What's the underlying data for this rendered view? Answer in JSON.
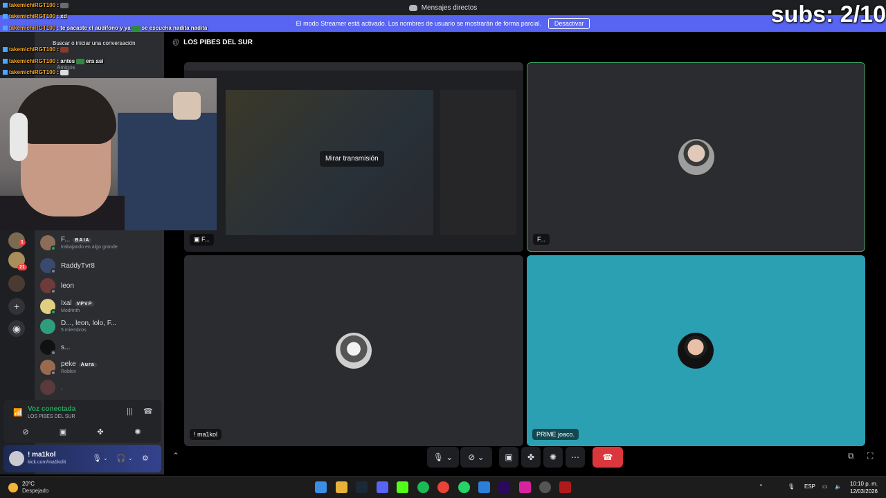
{
  "titlebar": {
    "title": "Mensajes directos"
  },
  "banner": {
    "text": "El modo Streamer está activado. Los nombres de usuario se mostrarán de forma parcial.",
    "button": "Desactivar"
  },
  "overlay": {
    "subs": "subs: 2/10"
  },
  "chat": {
    "messages": [
      {
        "user": "takemichiRGT100",
        "text": ":"
      },
      {
        "user": "takemichiRGT100",
        "text": ": xd"
      },
      {
        "user": "takemichiRGT100",
        "text": ": te sacaste el audifono y ya"
      },
      {
        "user": "",
        "text": "se escucha nadita nadita"
      },
      {
        "user": "takemichiRGT100",
        "text": ":"
      },
      {
        "user": "takemichiRGT100",
        "text": ": antes"
      },
      {
        "user": "",
        "text": "era asi"
      },
      {
        "user": "takemichiRGT100",
        "text": ":"
      }
    ]
  },
  "sidebar": {
    "search_placeholder": "Buscar o iniciar una conversación",
    "friends": "Amigos",
    "badges": {
      "b1": "1",
      "b2": "21"
    },
    "items": [
      {
        "name": "F...",
        "tag": "BAIA",
        "sub": "trabajando en algo grande"
      },
      {
        "name": "RaddyTvr8",
        "sub": ""
      },
      {
        "name": "leon",
        "sub": ""
      },
      {
        "name": "Ixal",
        "tag": "VPVP",
        "sub": "Modrinth"
      },
      {
        "name": "D..., leon, lolo, F...",
        "sub": "5 miembros"
      },
      {
        "name": "s...",
        "sub": ""
      },
      {
        "name": "peke",
        "tag": "Aura",
        "sub": "Roblox"
      },
      {
        "name": ".",
        "sub": ""
      }
    ]
  },
  "voice": {
    "status": "Voz conectada",
    "channel": "LOS PIBES DEL SUR"
  },
  "user": {
    "name": "! ma1kol",
    "status": "kick.com/ma1kolit"
  },
  "main": {
    "channel_title": "LOS PIBES DEL SUR",
    "tiles": [
      {
        "label": "F...",
        "overlay": "Mirar transmisión"
      },
      {
        "label": "F..."
      },
      {
        "label": "! ma1kol"
      },
      {
        "label": "PRIME joaco."
      }
    ]
  },
  "taskbar": {
    "temp": "20°C",
    "weather": "Despejado",
    "lang": "ESP",
    "time": "10:10 p. m.",
    "date": "12/03/2026"
  },
  "colors": {
    "accent": "#5865f2",
    "voice_green": "#23a55a",
    "hangup": "#da373c",
    "teal_tile": "#2aa0b2"
  }
}
